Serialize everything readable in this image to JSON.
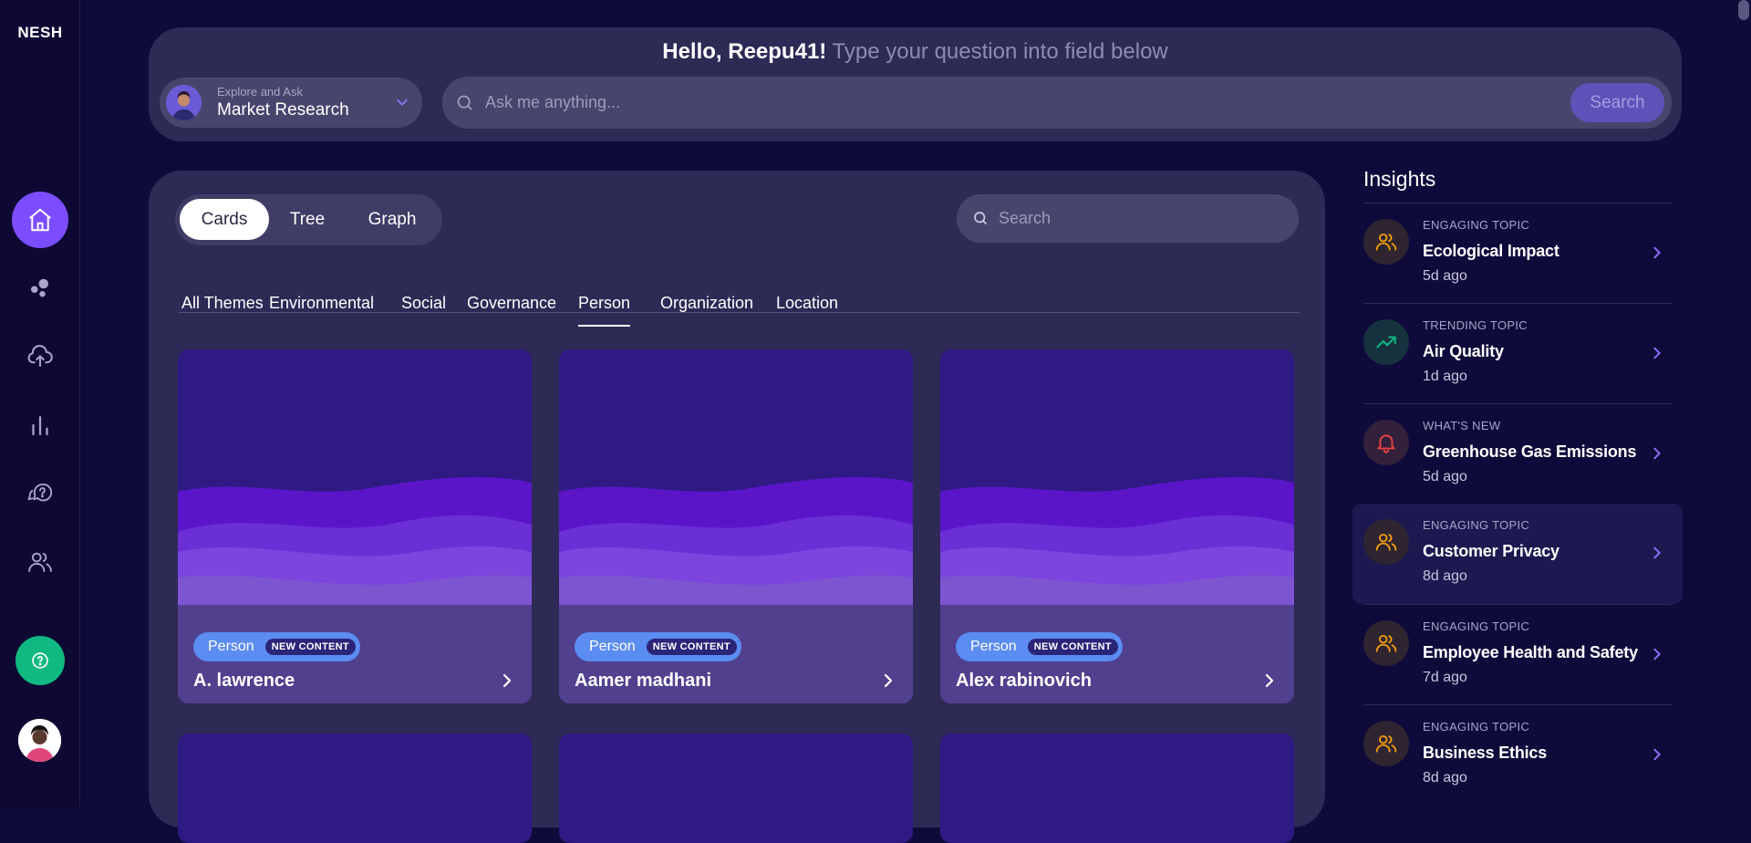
{
  "app": {
    "logo": "NESH"
  },
  "sidebar": {
    "nav": [
      {
        "name": "home-icon",
        "active": true
      },
      {
        "name": "clusters-icon",
        "active": false
      },
      {
        "name": "upload-icon",
        "active": false
      },
      {
        "name": "analytics-icon",
        "active": false
      },
      {
        "name": "questions-icon",
        "active": false
      },
      {
        "name": "users-icon",
        "active": false
      }
    ],
    "help_icon": "help-icon",
    "avatar_icon": "user-avatar"
  },
  "ask": {
    "greeting_name": "Hello, Reepu41!",
    "greeting_hint": "Type your question into field below",
    "topic_small": "Explore and Ask",
    "topic_main": "Market Research",
    "placeholder": "Ask me anything...",
    "search_label": "Search"
  },
  "views": {
    "tabs": [
      "Cards",
      "Tree",
      "Graph"
    ],
    "active": "Cards"
  },
  "content_search": {
    "placeholder": "Search"
  },
  "themes": {
    "tabs": [
      "All Themes",
      "Environmental",
      "Social",
      "Governance",
      "Person",
      "Organization",
      "Location"
    ],
    "active": "Person"
  },
  "cards": [
    {
      "tag": "Person",
      "badge": "NEW CONTENT",
      "name": "A. lawrence"
    },
    {
      "tag": "Person",
      "badge": "NEW CONTENT",
      "name": "Aamer madhani"
    },
    {
      "tag": "Person",
      "badge": "NEW CONTENT",
      "name": "Alex rabinovich"
    }
  ],
  "insights": {
    "title": "Insights",
    "items": [
      {
        "kicker": "ENGAGING TOPIC",
        "title": "Ecological Impact",
        "time": "5d ago",
        "icon": "people-icon",
        "color": "#f59e0b"
      },
      {
        "kicker": "TRENDING TOPIC",
        "title": "Air Quality",
        "time": "1d ago",
        "icon": "trending-icon",
        "color": "#10b981"
      },
      {
        "kicker": "WHAT'S NEW",
        "title": "Greenhouse Gas Emissions",
        "time": "5d ago",
        "icon": "bell-icon",
        "color": "#ef4444"
      },
      {
        "kicker": "ENGAGING TOPIC",
        "title": "Customer Privacy",
        "time": "8d ago",
        "icon": "people-icon",
        "color": "#f59e0b"
      },
      {
        "kicker": "ENGAGING TOPIC",
        "title": "Employee Health and Safety",
        "time": "7d ago",
        "icon": "people-icon",
        "color": "#f59e0b"
      },
      {
        "kicker": "ENGAGING TOPIC",
        "title": "Business Ethics",
        "time": "8d ago",
        "icon": "people-icon",
        "color": "#f59e0b"
      }
    ]
  },
  "colors": {
    "background": "#0e0a3a",
    "panel": "#2d2a55",
    "accent": "#7c4dff",
    "card": "#2f1a84",
    "tag": "#5b8cf1",
    "help": "#10b981"
  }
}
